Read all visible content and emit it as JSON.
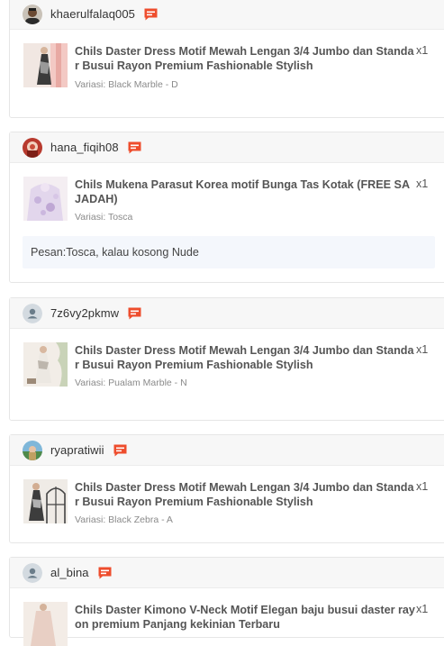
{
  "orders": [
    {
      "username": "khaerulfalaq005",
      "avatar": "photo-avatar-man",
      "chat_icon": "chat-icon",
      "product_name": "Chils Daster Dress Motif Mewah Lengan 3/4 Jumbo dan Standar Busui Rayon Premium Fashionable Stylish",
      "quantity": "x1",
      "variant": "Variasi: Black Marble - D",
      "note": ""
    },
    {
      "username": "hana_fiqih08",
      "avatar": "photo-avatar-red",
      "chat_icon": "chat-icon",
      "product_name": "Chils Mukena Parasut Korea motif Bunga Tas Kotak (FREE SAJADAH)",
      "quantity": "x1",
      "variant": "Variasi: Tosca",
      "note": "Pesan:Tosca, kalau kosong Nude"
    },
    {
      "username": "7z6vy2pkmw",
      "avatar": "default-user-avatar",
      "chat_icon": "chat-icon",
      "product_name": "Chils Daster Dress Motif Mewah Lengan 3/4 Jumbo dan Standar Busui Rayon Premium Fashionable Stylish",
      "quantity": "x1",
      "variant": "Variasi: Pualam Marble - N",
      "note": ""
    },
    {
      "username": "ryapratiwii",
      "avatar": "photo-avatar-outdoor",
      "chat_icon": "chat-icon",
      "product_name": "Chils Daster Dress Motif Mewah Lengan 3/4 Jumbo dan Standar Busui Rayon Premium Fashionable Stylish",
      "quantity": "x1",
      "variant": "Variasi: Black Zebra - A",
      "note": ""
    },
    {
      "username": "al_bina",
      "avatar": "default-user-avatar",
      "chat_icon": "chat-icon",
      "product_name": "Chils Daster Kimono V-Neck Motif Elegan baju busui daster rayon premium Panjang kekinian Terbaru",
      "quantity": "x1",
      "variant": "",
      "note": ""
    }
  ],
  "colors": {
    "accent": "#ee4d2d",
    "header_bg": "#f7f7f7",
    "note_bg": "#f4f7fc",
    "variant_text": "#8a8a8a"
  }
}
